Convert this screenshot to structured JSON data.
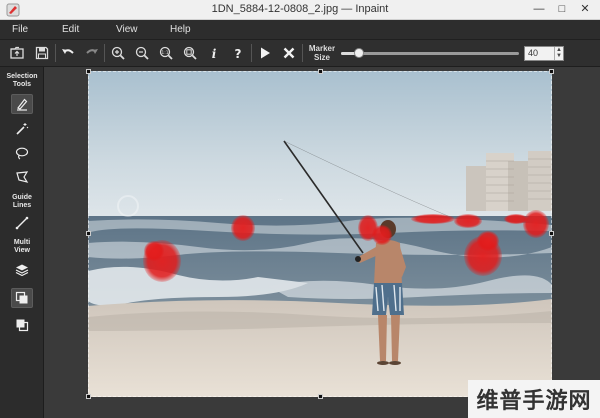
{
  "window": {
    "title": "1DN_5884-12-0808_2.jpg — Inpaint"
  },
  "menu": [
    "File",
    "Edit",
    "View",
    "Help"
  ],
  "toolbar": {
    "marker_label_line1": "Marker",
    "marker_label_line2": "Size",
    "marker_size_value": "40",
    "marker_size_fraction": 0.1,
    "buttons": [
      "open-icon",
      "save-icon",
      "undo-icon",
      "redo-icon",
      "zoom-in-icon",
      "zoom-out-icon",
      "actual-size-icon",
      "fit-icon",
      "info-icon",
      "help-icon",
      "run-icon",
      "cancel-icon"
    ]
  },
  "sidebar": {
    "selection_tools_line1": "Selection",
    "selection_tools_line2": "Tools",
    "guide_lines_line1": "Guide",
    "guide_lines_line2": "Lines",
    "multi_view_line1": "Multi",
    "multi_view_line2": "View"
  },
  "photo": {
    "sign_text": "···"
  },
  "watermark": {
    "text": "维普手游网"
  },
  "colors": {
    "accent_marker": "#e02020",
    "toolbar_bg": "#2f2f2f",
    "canvas_bg": "#3a3a3a"
  }
}
